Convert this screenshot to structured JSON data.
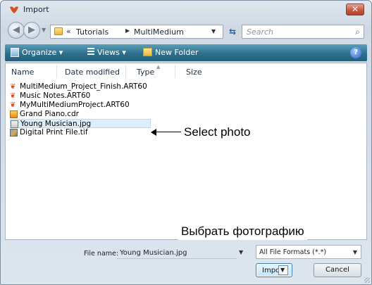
{
  "window": {
    "title": "Import",
    "close_glyph": "✕"
  },
  "address": {
    "back_glyph": "◀",
    "forward_glyph": "▶",
    "crumb_separator_lead": "«",
    "crumbs": [
      "Tutorials",
      "MultiMedium"
    ],
    "crumb_separator": "▶",
    "dropdown_glyph": "▼",
    "refresh_glyph": "⇆"
  },
  "search": {
    "placeholder": "Search",
    "icon_glyph": "⌕"
  },
  "toolbar": {
    "organize_label": "Organize ▾",
    "views_label": "Views ▾",
    "new_folder_label": "New Folder",
    "help_glyph": "?"
  },
  "columns": [
    "Name",
    "Date modified",
    "Type",
    "Size"
  ],
  "files": [
    {
      "name": "MultiMedium_Project_Finish.ART60",
      "icon": "art-icon",
      "glyph": "❦"
    },
    {
      "name": "Music Notes.ART60",
      "icon": "art-icon",
      "glyph": "❦"
    },
    {
      "name": "MyMultiMediumProject.ART60",
      "icon": "art-icon",
      "glyph": "❦"
    },
    {
      "name": "Grand Piano.cdr",
      "icon": "cdr-icon",
      "glyph": ""
    },
    {
      "name": "Young Musician.jpg",
      "icon": "jpg-icon",
      "glyph": ""
    },
    {
      "name": "Digital Print File.tif",
      "icon": "tif-icon",
      "glyph": ""
    }
  ],
  "callouts": {
    "select_photo": "Select photo",
    "select_photo_ru": "Выбрать фотографию"
  },
  "bottom": {
    "filename_label": "File name:",
    "filename_value": "Young Musician.jpg",
    "filetype_value": "All File Formats (*.*)",
    "import_label": "Import",
    "cancel_label": "Cancel",
    "dropdown_glyph": "▼"
  },
  "colors": {
    "toolbar": "#2e6f8c",
    "close_button": "#c75a42",
    "selected_row": "#ddeefb"
  }
}
